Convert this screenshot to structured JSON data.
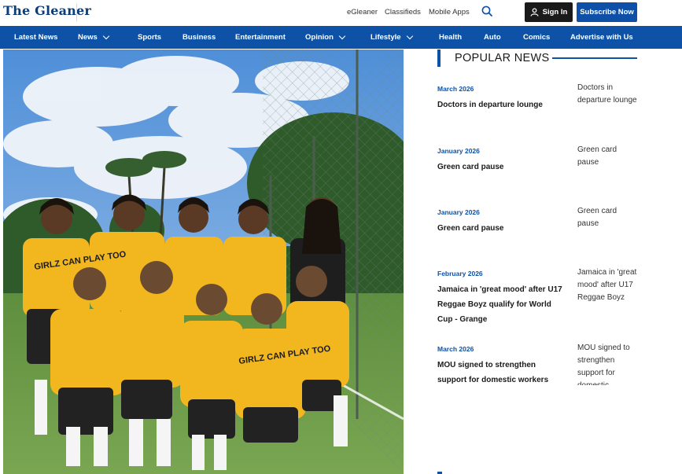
{
  "header": {
    "logo": "The Gleaner",
    "links": [
      "eGleaner",
      "Classifieds",
      "Mobile Apps"
    ],
    "sign_in": "Sign In",
    "subscribe": "Subscribe Now"
  },
  "nav": {
    "items": [
      {
        "label": "Latest News"
      },
      {
        "label": "News"
      },
      {
        "label": "Sports"
      },
      {
        "label": "Business"
      },
      {
        "label": "Entertainment"
      },
      {
        "label": "Opinion"
      },
      {
        "label": "Lifestyle"
      },
      {
        "label": "Health"
      },
      {
        "label": "Auto"
      },
      {
        "label": "Comics"
      },
      {
        "label": "Advertise with Us"
      }
    ]
  },
  "photo": {
    "shirt_text": "GIRLZ CAN PLAY TOO"
  },
  "popular": {
    "title": "POPULAR NEWS",
    "items": [
      {
        "date": "March 2026",
        "headline": "Doctors in departure lounge",
        "thumb": "Doctors in departure lounge"
      },
      {
        "date": "January 2026",
        "headline": "Green card pause",
        "thumb": "Green card pause"
      },
      {
        "date": "January 2026",
        "headline": "Green card pause",
        "thumb": "Green card pause"
      },
      {
        "date": "February 2026",
        "headline": "Jamaica in 'great mood' after U17 Reggae Boyz qualify for World Cup - Grange",
        "thumb": "Jamaica in 'great mood' after U17 Reggae Boyz"
      },
      {
        "date": "March 2026",
        "headline": "MOU signed to strengthen support for domestic workers",
        "thumb": "MOU signed to strengthen support for domestic"
      }
    ]
  },
  "colors": {
    "brand_blue": "#0e52a8",
    "dark": "#1a1a1a"
  }
}
